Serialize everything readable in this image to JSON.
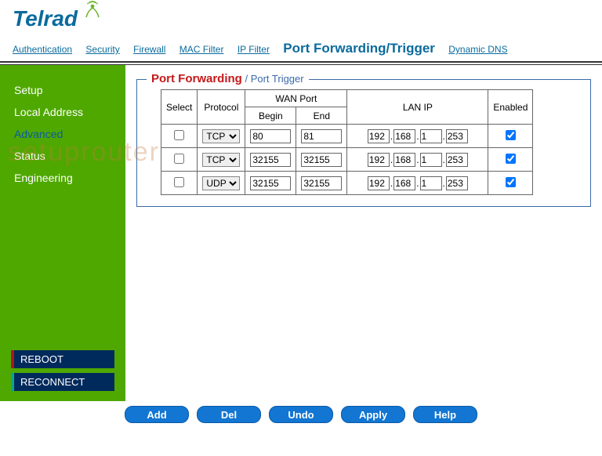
{
  "logo_text": "Telrad",
  "topnav": [
    {
      "label": "Authentication"
    },
    {
      "label": "Security"
    },
    {
      "label": "Firewall"
    },
    {
      "label": "MAC Filter"
    },
    {
      "label": "IP Filter"
    },
    {
      "label": "Port Forwarding/Trigger",
      "active": true
    },
    {
      "label": "Dynamic DNS"
    }
  ],
  "sidebar": [
    {
      "label": "Setup"
    },
    {
      "label": "Local Address"
    },
    {
      "label": "Advanced",
      "active": true
    },
    {
      "label": "Status"
    },
    {
      "label": "Engineering"
    }
  ],
  "sidebar_buttons": {
    "reboot": "REBOOT",
    "reconnect": "RECONNECT"
  },
  "legend": {
    "pf": "Port Forwarding",
    "sep": " / ",
    "pt": "Port Trigger"
  },
  "headers": {
    "select": "Select",
    "protocol": "Protocol",
    "wan_port": "WAN Port",
    "begin": "Begin",
    "end": "End",
    "lan_ip": "LAN IP",
    "enabled": "Enabled"
  },
  "protocol_options": [
    "TCP",
    "UDP"
  ],
  "rows": [
    {
      "select": false,
      "protocol": "TCP",
      "begin": "80",
      "end": "81",
      "ip": [
        "192",
        "168",
        "1",
        "253"
      ],
      "enabled": true
    },
    {
      "select": false,
      "protocol": "TCP",
      "begin": "32155",
      "end": "32155",
      "ip": [
        "192",
        "168",
        "1",
        "253"
      ],
      "enabled": true
    },
    {
      "select": false,
      "protocol": "UDP",
      "begin": "32155",
      "end": "32155",
      "ip": [
        "192",
        "168",
        "1",
        "253"
      ],
      "enabled": true
    }
  ],
  "actions": {
    "add": "Add",
    "del": "Del",
    "undo": "Undo",
    "apply": "Apply",
    "help": "Help"
  },
  "watermark": "setuprouter"
}
